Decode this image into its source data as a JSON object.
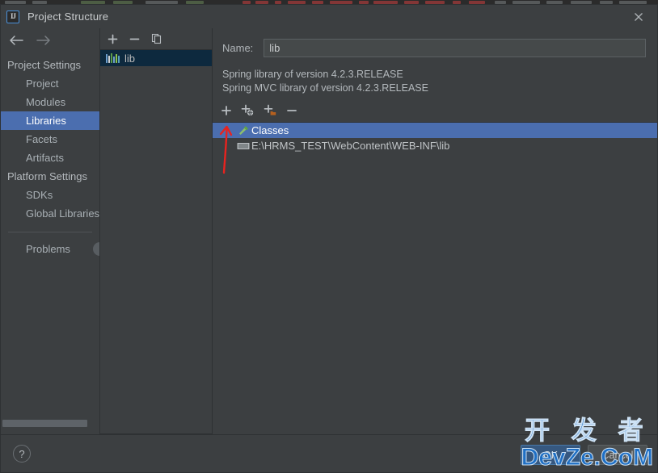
{
  "window": {
    "title": "Project Structure",
    "app_icon": "intellij-idea-logo",
    "close_icon": "close-icon"
  },
  "nav": {
    "back_icon": "arrow-left-icon",
    "forward_icon": "arrow-right-icon"
  },
  "sidebar": {
    "groups": [
      {
        "label": "Project Settings",
        "items": [
          {
            "label": "Project",
            "selected": false
          },
          {
            "label": "Modules",
            "selected": false
          },
          {
            "label": "Libraries",
            "selected": true
          },
          {
            "label": "Facets",
            "selected": false
          },
          {
            "label": "Artifacts",
            "selected": false
          }
        ]
      },
      {
        "label": "Platform Settings",
        "items": [
          {
            "label": "SDKs",
            "selected": false
          },
          {
            "label": "Global Libraries",
            "selected": false
          }
        ]
      }
    ],
    "problems": {
      "label": "Problems",
      "badge_icon": "problems-count-badge"
    },
    "scrollbar_icon": "horizontal-scrollbar"
  },
  "library_list": {
    "toolbar": [
      {
        "name": "add-library-button",
        "icon": "plus-icon",
        "label": "+"
      },
      {
        "name": "remove-library-button",
        "icon": "minus-icon",
        "label": "−"
      },
      {
        "name": "copy-library-button",
        "icon": "copy-icon",
        "label": "copy"
      }
    ],
    "items": [
      {
        "label": "lib",
        "icon": "library-books-icon",
        "selected": true
      }
    ]
  },
  "detail": {
    "name_label": "Name:",
    "name_value": "lib",
    "name_placeholder": "",
    "descriptions": [
      "Spring library of version 4.2.3.RELEASE",
      "Spring MVC library of version 4.2.3.RELEASE"
    ],
    "toolbar": [
      {
        "name": "add-root-button",
        "icon": "plus-icon"
      },
      {
        "name": "add-maven-root-button",
        "icon": "plus-globe-icon"
      },
      {
        "name": "add-directory-root-button",
        "icon": "plus-folder-icon"
      },
      {
        "name": "remove-root-button",
        "icon": "minus-icon"
      }
    ],
    "tree": [
      {
        "label": "Classes",
        "icon": "hammer-icon",
        "selected": true,
        "children": [
          {
            "label": "E:\\HRMS_TEST\\WebContent\\WEB-INF\\lib",
            "icon": "jar-archive-icon"
          }
        ]
      }
    ],
    "annotation_icon": "red-arrow-annotation"
  },
  "footer": {
    "help_label": "?",
    "ok_label": "OK",
    "cancel_label": "Cancel"
  },
  "watermark": {
    "line1": "开 发 者",
    "line2": "DevZe.CoM",
    "color": "#1f6fc4"
  },
  "colors": {
    "dialog_bg": "#3c3f41",
    "selection_blue": "#4b6eaf",
    "list_selection": "#0d293e",
    "primary_button": "#365880",
    "annotation_red": "#e8231f",
    "editor_bg": "#2b2b2b"
  }
}
